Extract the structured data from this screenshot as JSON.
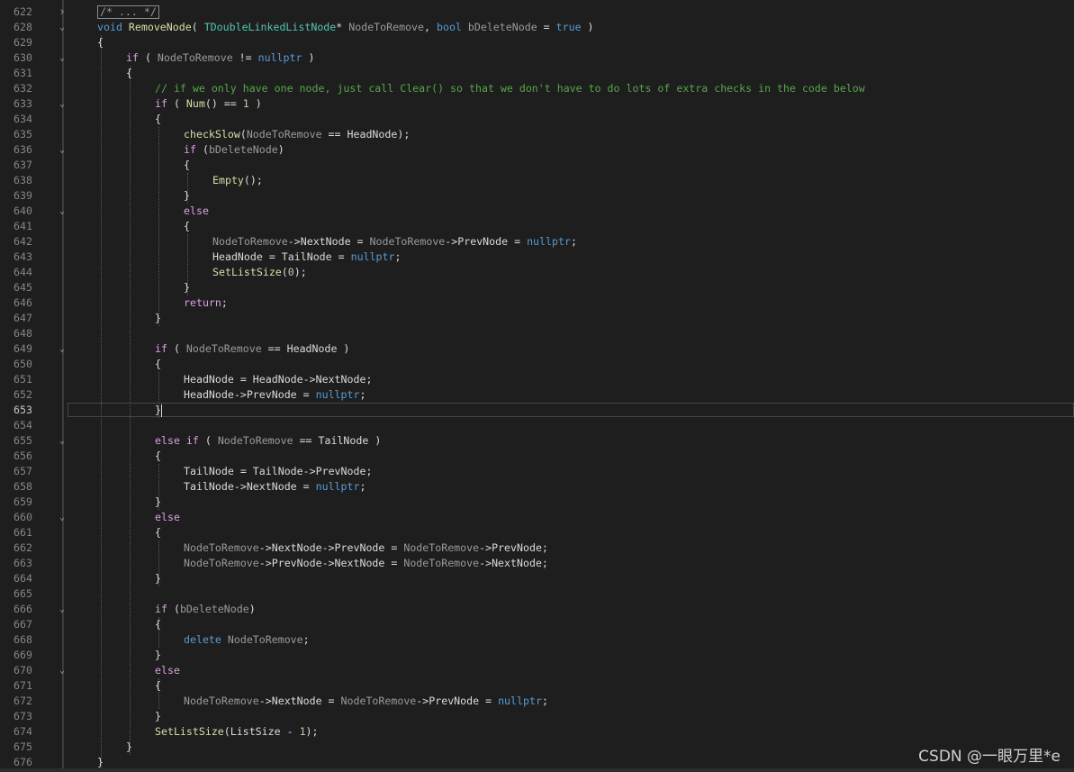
{
  "editor": {
    "lines": [
      {
        "no": "622",
        "fold": "expand",
        "indent": 1,
        "tokens": [
          {
            "t": "/* ... */",
            "c": "box"
          }
        ]
      },
      {
        "no": "628",
        "fold": "collapse",
        "indent": 1,
        "tokens": [
          {
            "t": "void",
            "c": "kw"
          },
          {
            "t": " "
          },
          {
            "t": "RemoveNode",
            "c": "fn"
          },
          {
            "t": "( "
          },
          {
            "t": "TDoubleLinkedListNode",
            "c": "type"
          },
          {
            "t": "* "
          },
          {
            "t": "NodeToRemove",
            "c": "param"
          },
          {
            "t": ", "
          },
          {
            "t": "bool",
            "c": "kw"
          },
          {
            "t": " "
          },
          {
            "t": "bDeleteNode",
            "c": "param"
          },
          {
            "t": " = "
          },
          {
            "t": "true",
            "c": "kw"
          },
          {
            "t": " )"
          }
        ]
      },
      {
        "no": "629",
        "fold": "",
        "indent": 1,
        "tokens": [
          {
            "t": "{"
          }
        ]
      },
      {
        "no": "630",
        "fold": "collapse",
        "indent": 2,
        "tokens": [
          {
            "t": "if",
            "c": "ctrl"
          },
          {
            "t": " ( "
          },
          {
            "t": "NodeToRemove",
            "c": "param"
          },
          {
            "t": " != "
          },
          {
            "t": "nullptr",
            "c": "kw"
          },
          {
            "t": " )"
          }
        ]
      },
      {
        "no": "631",
        "fold": "",
        "indent": 2,
        "tokens": [
          {
            "t": "{"
          }
        ]
      },
      {
        "no": "632",
        "fold": "",
        "indent": 3,
        "tokens": [
          {
            "t": "// if we only have one node, just call Clear() so that we don't have to do lots of extra checks in the code below",
            "c": "com"
          }
        ]
      },
      {
        "no": "633",
        "fold": "collapse",
        "indent": 3,
        "tokens": [
          {
            "t": "if",
            "c": "ctrl"
          },
          {
            "t": " ( "
          },
          {
            "t": "Num",
            "c": "fn"
          },
          {
            "t": "() == "
          },
          {
            "t": "1",
            "c": "num"
          },
          {
            "t": " )"
          }
        ]
      },
      {
        "no": "634",
        "fold": "",
        "indent": 3,
        "tokens": [
          {
            "t": "{"
          }
        ]
      },
      {
        "no": "635",
        "fold": "",
        "indent": 4,
        "tokens": [
          {
            "t": "checkSlow",
            "c": "fn"
          },
          {
            "t": "("
          },
          {
            "t": "NodeToRemove",
            "c": "param"
          },
          {
            "t": " == "
          },
          {
            "t": "HeadNode",
            "c": "mem"
          },
          {
            "t": ");"
          }
        ]
      },
      {
        "no": "636",
        "fold": "collapse",
        "indent": 4,
        "tokens": [
          {
            "t": "if",
            "c": "ctrl"
          },
          {
            "t": " ("
          },
          {
            "t": "bDeleteNode",
            "c": "param"
          },
          {
            "t": ")"
          }
        ]
      },
      {
        "no": "637",
        "fold": "",
        "indent": 4,
        "tokens": [
          {
            "t": "{"
          }
        ]
      },
      {
        "no": "638",
        "fold": "",
        "indent": 5,
        "tokens": [
          {
            "t": "Empty",
            "c": "fn"
          },
          {
            "t": "();"
          }
        ]
      },
      {
        "no": "639",
        "fold": "",
        "indent": 4,
        "tokens": [
          {
            "t": "}"
          }
        ]
      },
      {
        "no": "640",
        "fold": "collapse",
        "indent": 4,
        "tokens": [
          {
            "t": "else",
            "c": "ctrl"
          }
        ]
      },
      {
        "no": "641",
        "fold": "",
        "indent": 4,
        "tokens": [
          {
            "t": "{"
          }
        ]
      },
      {
        "no": "642",
        "fold": "",
        "indent": 5,
        "tokens": [
          {
            "t": "NodeToRemove",
            "c": "param"
          },
          {
            "t": "->"
          },
          {
            "t": "NextNode",
            "c": "mem"
          },
          {
            "t": " = "
          },
          {
            "t": "NodeToRemove",
            "c": "param"
          },
          {
            "t": "->"
          },
          {
            "t": "PrevNode",
            "c": "mem"
          },
          {
            "t": " = "
          },
          {
            "t": "nullptr",
            "c": "kw"
          },
          {
            "t": ";"
          }
        ]
      },
      {
        "no": "643",
        "fold": "",
        "indent": 5,
        "tokens": [
          {
            "t": "HeadNode",
            "c": "mem"
          },
          {
            "t": " = "
          },
          {
            "t": "TailNode",
            "c": "mem"
          },
          {
            "t": " = "
          },
          {
            "t": "nullptr",
            "c": "kw"
          },
          {
            "t": ";"
          }
        ]
      },
      {
        "no": "644",
        "fold": "",
        "indent": 5,
        "tokens": [
          {
            "t": "SetListSize",
            "c": "fn"
          },
          {
            "t": "("
          },
          {
            "t": "0",
            "c": "num"
          },
          {
            "t": ");"
          }
        ]
      },
      {
        "no": "645",
        "fold": "",
        "indent": 4,
        "tokens": [
          {
            "t": "}"
          }
        ]
      },
      {
        "no": "646",
        "fold": "",
        "indent": 4,
        "tokens": [
          {
            "t": "return",
            "c": "ctrl"
          },
          {
            "t": ";"
          }
        ]
      },
      {
        "no": "647",
        "fold": "",
        "indent": 3,
        "tokens": [
          {
            "t": "}"
          }
        ]
      },
      {
        "no": "648",
        "fold": "",
        "indent": 3,
        "tokens": []
      },
      {
        "no": "649",
        "fold": "collapse",
        "indent": 3,
        "tokens": [
          {
            "t": "if",
            "c": "ctrl"
          },
          {
            "t": " ( "
          },
          {
            "t": "NodeToRemove",
            "c": "param"
          },
          {
            "t": " == "
          },
          {
            "t": "HeadNode",
            "c": "mem"
          },
          {
            "t": " )"
          }
        ]
      },
      {
        "no": "650",
        "fold": "",
        "indent": 3,
        "tokens": [
          {
            "t": "{"
          }
        ]
      },
      {
        "no": "651",
        "fold": "",
        "indent": 4,
        "tokens": [
          {
            "t": "HeadNode",
            "c": "mem"
          },
          {
            "t": " = "
          },
          {
            "t": "HeadNode",
            "c": "mem"
          },
          {
            "t": "->"
          },
          {
            "t": "NextNode",
            "c": "mem"
          },
          {
            "t": ";"
          }
        ]
      },
      {
        "no": "652",
        "fold": "",
        "indent": 4,
        "tokens": [
          {
            "t": "HeadNode",
            "c": "mem"
          },
          {
            "t": "->"
          },
          {
            "t": "PrevNode",
            "c": "mem"
          },
          {
            "t": " = "
          },
          {
            "t": "nullptr",
            "c": "kw"
          },
          {
            "t": ";"
          }
        ]
      },
      {
        "no": "653",
        "fold": "",
        "indent": 3,
        "current": true,
        "tokens": [
          {
            "t": "}"
          },
          {
            "t": "",
            "c": "caret"
          }
        ]
      },
      {
        "no": "654",
        "fold": "",
        "indent": 3,
        "tokens": []
      },
      {
        "no": "655",
        "fold": "collapse",
        "indent": 3,
        "tokens": [
          {
            "t": "else",
            "c": "ctrl"
          },
          {
            "t": " "
          },
          {
            "t": "if",
            "c": "ctrl"
          },
          {
            "t": " ( "
          },
          {
            "t": "NodeToRemove",
            "c": "param"
          },
          {
            "t": " == "
          },
          {
            "t": "TailNode",
            "c": "mem"
          },
          {
            "t": " )"
          }
        ]
      },
      {
        "no": "656",
        "fold": "",
        "indent": 3,
        "tokens": [
          {
            "t": "{"
          }
        ]
      },
      {
        "no": "657",
        "fold": "",
        "indent": 4,
        "tokens": [
          {
            "t": "TailNode",
            "c": "mem"
          },
          {
            "t": " = "
          },
          {
            "t": "TailNode",
            "c": "mem"
          },
          {
            "t": "->"
          },
          {
            "t": "PrevNode",
            "c": "mem"
          },
          {
            "t": ";"
          }
        ]
      },
      {
        "no": "658",
        "fold": "",
        "indent": 4,
        "tokens": [
          {
            "t": "TailNode",
            "c": "mem"
          },
          {
            "t": "->"
          },
          {
            "t": "NextNode",
            "c": "mem"
          },
          {
            "t": " = "
          },
          {
            "t": "nullptr",
            "c": "kw"
          },
          {
            "t": ";"
          }
        ]
      },
      {
        "no": "659",
        "fold": "",
        "indent": 3,
        "tokens": [
          {
            "t": "}"
          }
        ]
      },
      {
        "no": "660",
        "fold": "collapse",
        "indent": 3,
        "tokens": [
          {
            "t": "else",
            "c": "ctrl"
          }
        ]
      },
      {
        "no": "661",
        "fold": "",
        "indent": 3,
        "tokens": [
          {
            "t": "{"
          }
        ]
      },
      {
        "no": "662",
        "fold": "",
        "indent": 4,
        "tokens": [
          {
            "t": "NodeToRemove",
            "c": "param"
          },
          {
            "t": "->"
          },
          {
            "t": "NextNode",
            "c": "mem"
          },
          {
            "t": "->"
          },
          {
            "t": "PrevNode",
            "c": "mem"
          },
          {
            "t": " = "
          },
          {
            "t": "NodeToRemove",
            "c": "param"
          },
          {
            "t": "->"
          },
          {
            "t": "PrevNode",
            "c": "mem"
          },
          {
            "t": ";"
          }
        ]
      },
      {
        "no": "663",
        "fold": "",
        "indent": 4,
        "tokens": [
          {
            "t": "NodeToRemove",
            "c": "param"
          },
          {
            "t": "->"
          },
          {
            "t": "PrevNode",
            "c": "mem"
          },
          {
            "t": "->"
          },
          {
            "t": "NextNode",
            "c": "mem"
          },
          {
            "t": " = "
          },
          {
            "t": "NodeToRemove",
            "c": "param"
          },
          {
            "t": "->"
          },
          {
            "t": "NextNode",
            "c": "mem"
          },
          {
            "t": ";"
          }
        ]
      },
      {
        "no": "664",
        "fold": "",
        "indent": 3,
        "tokens": [
          {
            "t": "}"
          }
        ]
      },
      {
        "no": "665",
        "fold": "",
        "indent": 3,
        "tokens": []
      },
      {
        "no": "666",
        "fold": "collapse",
        "indent": 3,
        "tokens": [
          {
            "t": "if",
            "c": "ctrl"
          },
          {
            "t": " ("
          },
          {
            "t": "bDeleteNode",
            "c": "param"
          },
          {
            "t": ")"
          }
        ]
      },
      {
        "no": "667",
        "fold": "",
        "indent": 3,
        "tokens": [
          {
            "t": "{"
          }
        ]
      },
      {
        "no": "668",
        "fold": "",
        "indent": 4,
        "tokens": [
          {
            "t": "delete",
            "c": "kw"
          },
          {
            "t": " "
          },
          {
            "t": "NodeToRemove",
            "c": "param"
          },
          {
            "t": ";"
          }
        ]
      },
      {
        "no": "669",
        "fold": "",
        "indent": 3,
        "tokens": [
          {
            "t": "}"
          }
        ]
      },
      {
        "no": "670",
        "fold": "collapse",
        "indent": 3,
        "tokens": [
          {
            "t": "else",
            "c": "ctrl"
          }
        ]
      },
      {
        "no": "671",
        "fold": "",
        "indent": 3,
        "tokens": [
          {
            "t": "{"
          }
        ]
      },
      {
        "no": "672",
        "fold": "",
        "indent": 4,
        "tokens": [
          {
            "t": "NodeToRemove",
            "c": "param"
          },
          {
            "t": "->"
          },
          {
            "t": "NextNode",
            "c": "mem"
          },
          {
            "t": " = "
          },
          {
            "t": "NodeToRemove",
            "c": "param"
          },
          {
            "t": "->"
          },
          {
            "t": "PrevNode",
            "c": "mem"
          },
          {
            "t": " = "
          },
          {
            "t": "nullptr",
            "c": "kw"
          },
          {
            "t": ";"
          }
        ]
      },
      {
        "no": "673",
        "fold": "",
        "indent": 3,
        "tokens": [
          {
            "t": "}"
          }
        ]
      },
      {
        "no": "674",
        "fold": "",
        "indent": 3,
        "tokens": [
          {
            "t": "SetListSize",
            "c": "fn"
          },
          {
            "t": "("
          },
          {
            "t": "ListSize",
            "c": "mem"
          },
          {
            "t": " - "
          },
          {
            "t": "1",
            "c": "num"
          },
          {
            "t": ");"
          }
        ]
      },
      {
        "no": "675",
        "fold": "",
        "indent": 2,
        "tokens": [
          {
            "t": "}"
          }
        ]
      },
      {
        "no": "676",
        "fold": "",
        "indent": 1,
        "tokens": [
          {
            "t": "}"
          }
        ]
      }
    ],
    "guides": [
      {
        "col": 1,
        "from": 2,
        "to": 49
      },
      {
        "col": 2,
        "from": 4,
        "to": 48
      },
      {
        "col": 3,
        "from": 8,
        "to": 20
      },
      {
        "col": 4,
        "from": 11,
        "to": 12
      },
      {
        "col": 4,
        "from": 15,
        "to": 18
      },
      {
        "col": 3,
        "from": 24,
        "to": 26
      },
      {
        "col": 3,
        "from": 30,
        "to": 32
      },
      {
        "col": 3,
        "from": 35,
        "to": 37
      },
      {
        "col": 3,
        "from": 40,
        "to": 41
      },
      {
        "col": 3,
        "from": 44,
        "to": 45
      }
    ]
  },
  "icons": {
    "expand": "chevron-right-icon",
    "collapse": "chevron-down-icon"
  },
  "watermark": "CSDN @一眼万里*e"
}
